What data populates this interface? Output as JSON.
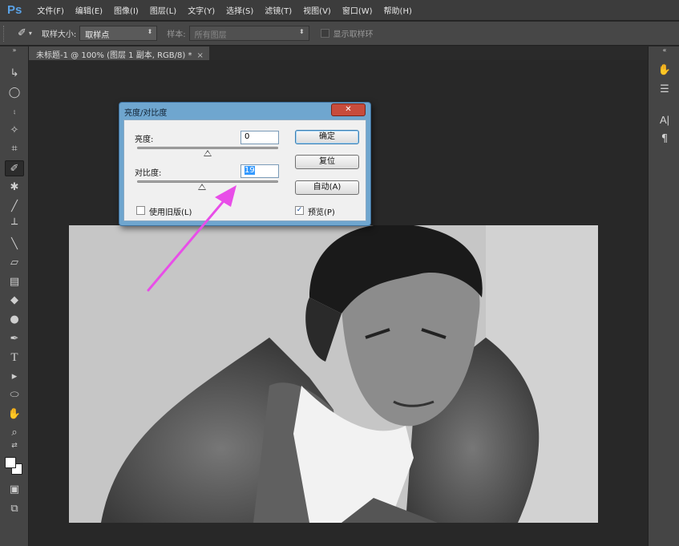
{
  "app": {
    "logo": "Ps"
  },
  "menubar": {
    "items": [
      "文件(F)",
      "编辑(E)",
      "图像(I)",
      "图层(L)",
      "文字(Y)",
      "选择(S)",
      "滤镜(T)",
      "视图(V)",
      "窗口(W)",
      "帮助(H)"
    ]
  },
  "options": {
    "sample_size_label": "取样大小:",
    "sample_size_value": "取样点",
    "sample_label": "样本:",
    "sample_value": "所有图层",
    "show_ring_label": "显示取样环"
  },
  "document": {
    "tab_title": "未标题-1 @ 100% (图层 1 副本, RGB/8) *",
    "tab_close": "×"
  },
  "dialog": {
    "title": "亮度/对比度",
    "close_glyph": "✕",
    "brightness_label": "亮度:",
    "brightness_value": "0",
    "contrast_label": "对比度:",
    "contrast_value": "19",
    "brightness_level": 0,
    "contrast_level": 19,
    "ok_label": "确定",
    "reset_label": "复位",
    "auto_label": "自动(A)",
    "legacy_label": "使用旧版(L)",
    "legacy_checked": false,
    "preview_label": "预览(P)",
    "preview_checked": true,
    "check_glyph": "✓"
  },
  "annotation": {
    "arrow_color": "#e84ee8"
  },
  "colors": {
    "ps_blue": "#5aa2e6",
    "dialog_frame": "#6fa6cf",
    "close_red": "#c84c3c"
  }
}
